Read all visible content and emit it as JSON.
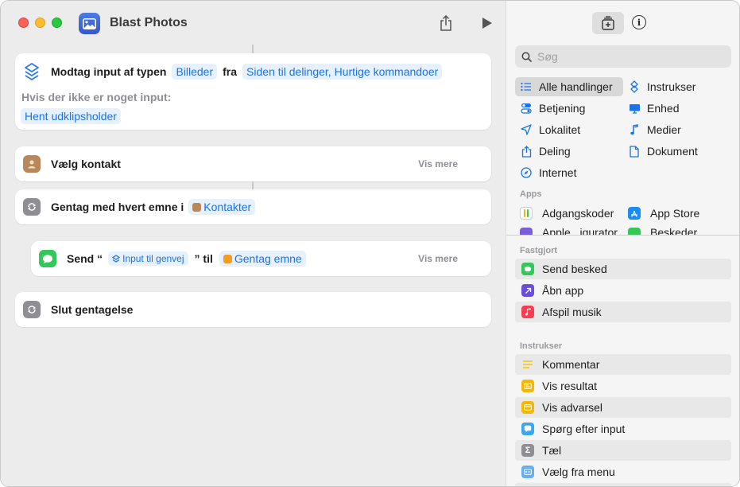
{
  "window": {
    "title": "Blast Photos"
  },
  "workflow": {
    "receive": {
      "label": "Modtag input af typen",
      "type_token": "Billeder",
      "from_label": "fra",
      "source_token": "Siden til delinger, Hurtige kommandoer",
      "no_input_label": "Hvis der ikke er noget input:",
      "fallback_token": "Hent udklipsholder"
    },
    "choose_contact": {
      "label": "Vælg kontakt",
      "more": "Vis mere"
    },
    "repeat": {
      "label": "Gentag med hvert emne i",
      "token": "Kontakter"
    },
    "send": {
      "prefix": "Send “",
      "input_token": "Input til genvej",
      "middle": "” til",
      "repeat_token": "Gentag emne",
      "more": "Vis mere"
    },
    "end_repeat": {
      "label": "Slut gentagelse"
    }
  },
  "library": {
    "search_placeholder": "Søg",
    "categories": [
      {
        "label": "Alle handlinger",
        "icon": "list-icon"
      },
      {
        "label": "Instrukser",
        "icon": "scripting-icon"
      },
      {
        "label": "Betjening",
        "icon": "toggle-icon"
      },
      {
        "label": "Enhed",
        "icon": "display-icon"
      },
      {
        "label": "Lokalitet",
        "icon": "location-arrow-icon"
      },
      {
        "label": "Medier",
        "icon": "music-note-icon"
      },
      {
        "label": "Deling",
        "icon": "share-icon"
      },
      {
        "label": "Dokument",
        "icon": "document-icon"
      },
      {
        "label": "Internet",
        "icon": "compass-icon"
      }
    ],
    "apps_header": "Apps",
    "apps": [
      {
        "label": "Adgangskoder"
      },
      {
        "label": "App Store"
      },
      {
        "label": "Apple...iqurator"
      },
      {
        "label": "Beskeder"
      }
    ],
    "pinned_header": "Fastgjort",
    "pinned": [
      {
        "label": "Send besked",
        "color": "#34c759"
      },
      {
        "label": "Åbn app",
        "color": "#6a4fd6"
      },
      {
        "label": "Afspil musik",
        "color": "#fa3b50"
      }
    ],
    "scripting_header": "Instrukser",
    "scripting": [
      {
        "label": "Kommentar",
        "color": "#f2c40f"
      },
      {
        "label": "Vis resultat",
        "color": "#f5b800"
      },
      {
        "label": "Vis advarsel",
        "color": "#f5b800"
      },
      {
        "label": "Spørg efter input",
        "color": "#38a8f0"
      },
      {
        "label": "Tæl",
        "color": "#8e8e93"
      },
      {
        "label": "Vælg fra menu",
        "color": "#68aef0"
      }
    ]
  }
}
